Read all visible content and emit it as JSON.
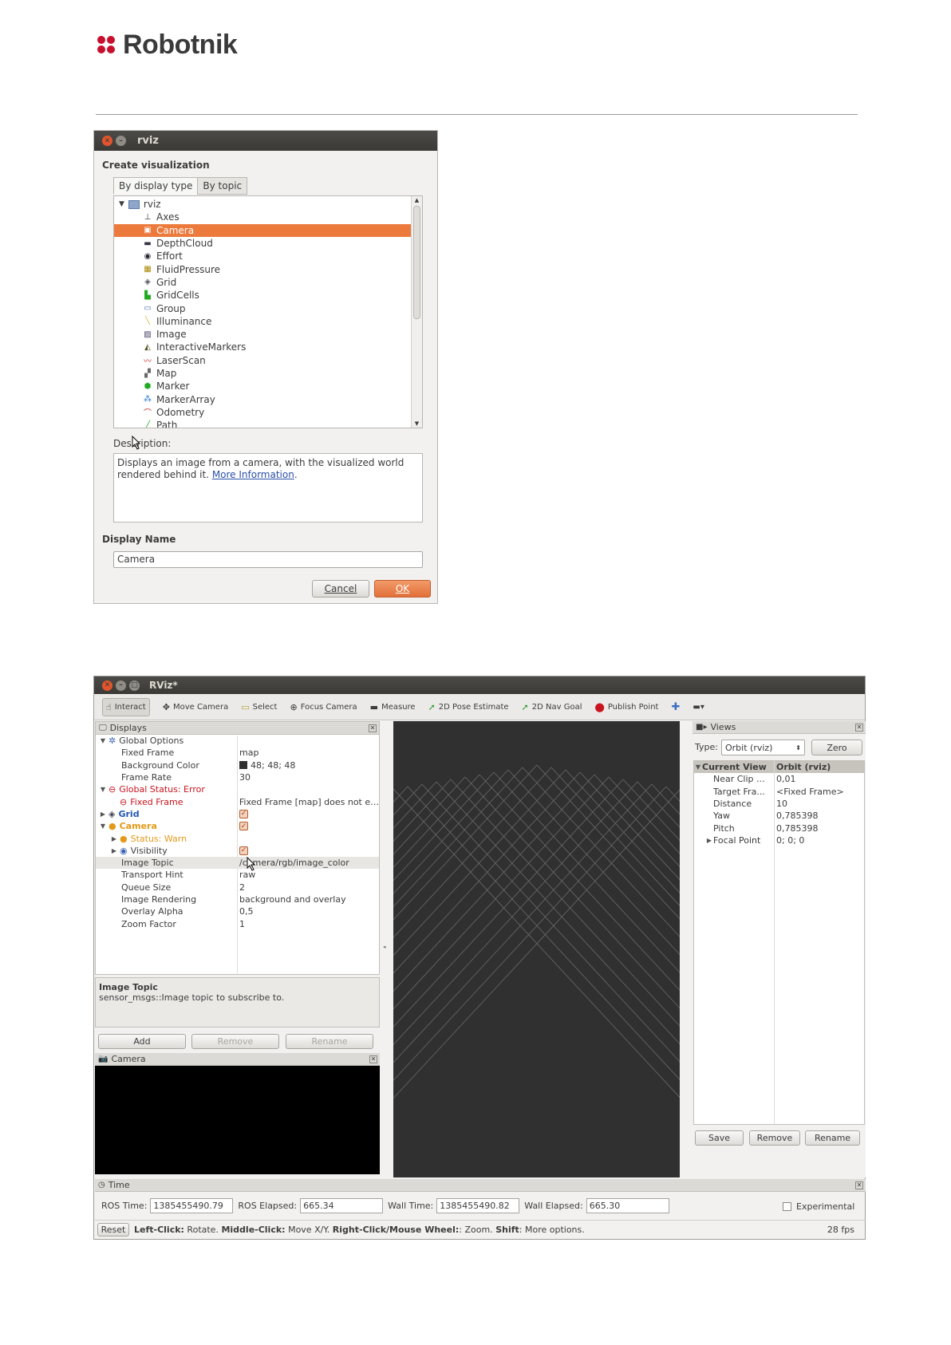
{
  "header": {
    "logo_text": "Robotnik",
    "logo_color": "#c8102e"
  },
  "dialog": {
    "window_title": "rviz",
    "section_title": "Create visualization",
    "tabs": [
      {
        "label": "By display type",
        "active": true
      },
      {
        "label": "By topic",
        "active": false
      }
    ],
    "tree_root": "rviz",
    "tree_items": [
      {
        "label": "Axes",
        "icon": "axes-icon",
        "selected": false
      },
      {
        "label": "Camera",
        "icon": "camera-icon",
        "selected": true
      },
      {
        "label": "DepthCloud",
        "icon": "depthcloud-icon",
        "selected": false
      },
      {
        "label": "Effort",
        "icon": "effort-icon",
        "selected": false
      },
      {
        "label": "FluidPressure",
        "icon": "fluidpressure-icon",
        "selected": false
      },
      {
        "label": "Grid",
        "icon": "grid-icon",
        "selected": false
      },
      {
        "label": "GridCells",
        "icon": "gridcells-icon",
        "selected": false
      },
      {
        "label": "Group",
        "icon": "group-icon",
        "selected": false
      },
      {
        "label": "Illuminance",
        "icon": "illuminance-icon",
        "selected": false
      },
      {
        "label": "Image",
        "icon": "image-icon",
        "selected": false
      },
      {
        "label": "InteractiveMarkers",
        "icon": "interactive-markers-icon",
        "selected": false
      },
      {
        "label": "LaserScan",
        "icon": "laserscan-icon",
        "selected": false
      },
      {
        "label": "Map",
        "icon": "map-icon",
        "selected": false
      },
      {
        "label": "Marker",
        "icon": "marker-icon",
        "selected": false
      },
      {
        "label": "MarkerArray",
        "icon": "marker-array-icon",
        "selected": false
      },
      {
        "label": "Odometry",
        "icon": "odometry-icon",
        "selected": false
      },
      {
        "label": "Path",
        "icon": "path-icon",
        "selected": false
      }
    ],
    "description_label": "Description:",
    "description_text": "Displays an image from a camera, with the visualized world rendered behind it.",
    "description_link": "More Information",
    "description_end": ".",
    "display_name_label": "Display Name",
    "display_name_value": "Camera",
    "cancel_label": "Cancel",
    "ok_label": "OK",
    "accent_color": "#ec7a3d"
  },
  "rviz": {
    "window_title": "RViz*",
    "toolbar": [
      {
        "label": "Interact",
        "icon": "hand-icon",
        "active": true
      },
      {
        "label": "Move Camera",
        "icon": "move-camera-icon",
        "active": false
      },
      {
        "label": "Select",
        "icon": "select-icon",
        "active": false
      },
      {
        "label": "Focus Camera",
        "icon": "focus-camera-icon",
        "active": false
      },
      {
        "label": "Measure",
        "icon": "measure-icon",
        "active": false
      },
      {
        "label": "2D Pose Estimate",
        "icon": "pose-estimate-icon",
        "active": false
      },
      {
        "label": "2D Nav Goal",
        "icon": "nav-goal-icon",
        "active": false
      },
      {
        "label": "Publish Point",
        "icon": "publish-point-icon",
        "active": false
      }
    ],
    "displays_title": "Displays",
    "displays": [
      {
        "key": "Global Options",
        "value": "",
        "indent": 0,
        "arrow": "down",
        "icon": "global-options-icon",
        "style": ""
      },
      {
        "key": "Fixed Frame",
        "value": "map",
        "indent": 2,
        "arrow": "",
        "icon": "",
        "style": ""
      },
      {
        "key": "Background Color",
        "value": "48; 48; 48",
        "indent": 2,
        "arrow": "",
        "icon": "",
        "style": "",
        "swatch": "#303030"
      },
      {
        "key": "Frame Rate",
        "value": "30",
        "indent": 2,
        "arrow": "",
        "icon": "",
        "style": ""
      },
      {
        "key": "Global Status: Error",
        "value": "",
        "indent": 0,
        "arrow": "down",
        "icon": "error-icon",
        "style": "red"
      },
      {
        "key": "Fixed Frame",
        "value": "Fixed Frame [map] does not e…",
        "indent": 1,
        "arrow": "",
        "icon": "error-icon",
        "style": "red"
      },
      {
        "key": "Grid",
        "value": "",
        "indent": 0,
        "arrow": "right",
        "icon": "grid-icon",
        "style": "blue",
        "check": true
      },
      {
        "key": "Camera",
        "value": "",
        "indent": 0,
        "arrow": "down",
        "icon": "warn-icon",
        "style": "orange",
        "check": true
      },
      {
        "key": "Status: Warn",
        "value": "",
        "indent": 1,
        "arrow": "right",
        "icon": "warn-icon",
        "style": "orange"
      },
      {
        "key": "Visibility",
        "value": "",
        "indent": 1,
        "arrow": "right",
        "icon": "visibility-icon",
        "style": "",
        "check": true
      },
      {
        "key": "Image Topic",
        "value": "/camera/rgb/image_color",
        "indent": 2,
        "arrow": "",
        "icon": "",
        "style": "",
        "selected": true
      },
      {
        "key": "Transport Hint",
        "value": "raw",
        "indent": 2,
        "arrow": "",
        "icon": "",
        "style": ""
      },
      {
        "key": "Queue Size",
        "value": "2",
        "indent": 2,
        "arrow": "",
        "icon": "",
        "style": ""
      },
      {
        "key": "Image Rendering",
        "value": "background and overlay",
        "indent": 2,
        "arrow": "",
        "icon": "",
        "style": ""
      },
      {
        "key": "Overlay Alpha",
        "value": "0,5",
        "indent": 2,
        "arrow": "",
        "icon": "",
        "style": ""
      },
      {
        "key": "Zoom Factor",
        "value": "1",
        "indent": 2,
        "arrow": "",
        "icon": "",
        "style": ""
      }
    ],
    "help_title": "Image Topic",
    "help_text": "sensor_msgs::Image topic to subscribe to.",
    "add_label": "Add",
    "remove_label": "Remove",
    "rename_label": "Rename",
    "camera_panel_title": "Camera",
    "views_title": "Views",
    "type_label": "Type:",
    "type_value": "Orbit (rviz)",
    "zero_label": "Zero",
    "current_view_label": "Current View",
    "current_view_value": "Orbit (rviz)",
    "view_props": [
      {
        "key": "Near Clip ...",
        "value": "0,01",
        "arrow": ""
      },
      {
        "key": "Target Fra...",
        "value": "<Fixed Frame>",
        "arrow": ""
      },
      {
        "key": "Distance",
        "value": "10",
        "arrow": ""
      },
      {
        "key": "Yaw",
        "value": "0,785398",
        "arrow": ""
      },
      {
        "key": "Pitch",
        "value": "0,785398",
        "arrow": ""
      },
      {
        "key": "Focal Point",
        "value": "0; 0; 0",
        "arrow": "right"
      }
    ],
    "views_save": "Save",
    "views_remove": "Remove",
    "views_rename": "Rename",
    "time_title": "Time",
    "ros_time_label": "ROS Time:",
    "ros_time_value": "1385455490.79",
    "ros_elapsed_label": "ROS Elapsed:",
    "ros_elapsed_value": "665.34",
    "wall_time_label": "Wall Time:",
    "wall_time_value": "1385455490.82",
    "wall_elapsed_label": "Wall Elapsed:",
    "wall_elapsed_value": "665.30",
    "experimental_label": "Experimental",
    "reset_label": "Reset",
    "status_parts": [
      {
        "text": "Left-Click:",
        "bold": true
      },
      {
        "text": " Rotate. ",
        "bold": false
      },
      {
        "text": "Middle-Click:",
        "bold": true
      },
      {
        "text": " Move X/Y. ",
        "bold": false
      },
      {
        "text": "Right-Click/Mouse Wheel:",
        "bold": true
      },
      {
        "text": ": Zoom. ",
        "bold": false
      },
      {
        "text": "Shift",
        "bold": true
      },
      {
        "text": ": More options.",
        "bold": false
      }
    ],
    "fps": "28 fps",
    "viewport_bg": "#303030"
  }
}
